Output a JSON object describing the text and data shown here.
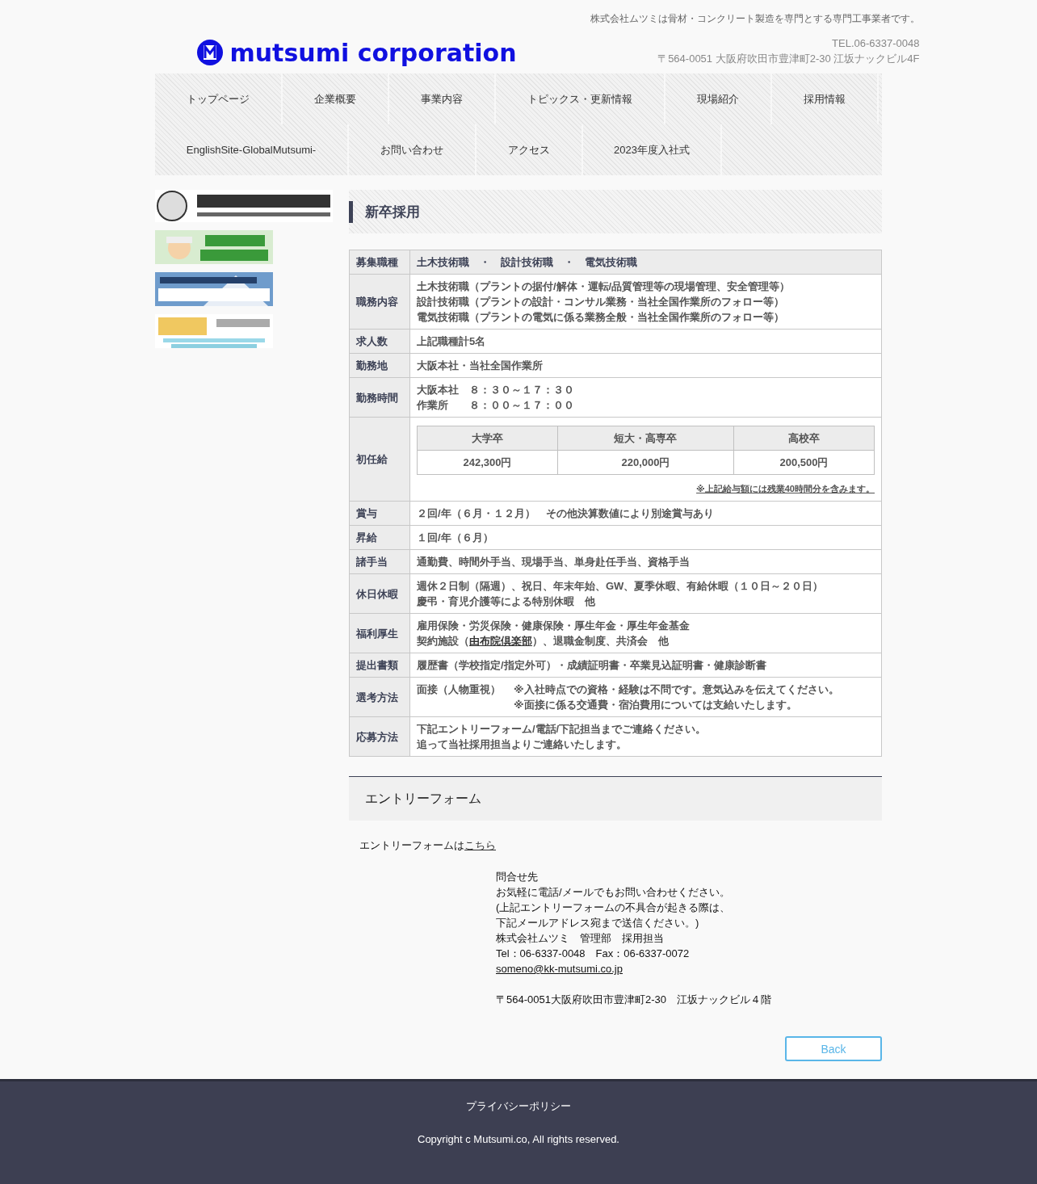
{
  "header": {
    "tagline": "株式会社ムツミは骨材・コンクリート製造を専門とする専門工事業者です。",
    "logo_text": "mutsumi corporation",
    "tel": "TEL.06-6337-0048",
    "address": "〒564-0051 大阪府吹田市豊津町2-30 江坂ナックビル4F"
  },
  "nav": [
    [
      "トップページ",
      "企業概要",
      "事業内容",
      "トピックス・更新情報",
      "現場紹介",
      "採用情報"
    ],
    [
      "EnglishSite-GlobalMutsumi-",
      "お問い合わせ",
      "アクセス",
      "2023年度入社式"
    ]
  ],
  "page_title": "新卒採用",
  "table": [
    {
      "label": "募集職種",
      "kind": "lines",
      "head": true,
      "lines": [
        "土木技術職　・　設計技術職　・　電気技術職"
      ]
    },
    {
      "label": "職務内容",
      "kind": "lines",
      "lines": [
        "土木技術職（プラントの据付/解体・運転/品質管理等の現場管理、安全管理等）",
        "設計技術職（プラントの設計・コンサル業務・当社全国作業所のフォロー等）",
        "電気技術職（プラントの電気に係る業務全般・当社全国作業所のフォロー等）"
      ]
    },
    {
      "label": "求人数",
      "kind": "lines",
      "lines": [
        "上記職種計5名"
      ]
    },
    {
      "label": "勤務地",
      "kind": "lines",
      "lines": [
        "大阪本社・当社全国作業所"
      ]
    },
    {
      "label": "勤務時間",
      "kind": "lines",
      "lines": [
        "大阪本社　８：３０～１７：３０",
        "作業所　　８：００～１７：００"
      ]
    },
    {
      "label": "初任給",
      "kind": "salary",
      "columns": [
        "大学卒",
        "短大・高専卒",
        "高校卒"
      ],
      "values": [
        "242,300円",
        "220,000円",
        "200,500円"
      ],
      "note": "※上記給与額には残業40時間分を含みます。"
    },
    {
      "label": "賞与",
      "kind": "lines",
      "lines": [
        "２回/年（６月・１２月）　その他決算数値により別途賞与あり"
      ]
    },
    {
      "label": "昇給",
      "kind": "lines",
      "lines": [
        "１回/年（６月）"
      ]
    },
    {
      "label": "諸手当",
      "kind": "lines",
      "lines": [
        "通勤費、時間外手当、現場手当、単身赴任手当、資格手当"
      ]
    },
    {
      "label": "休日休暇",
      "kind": "lines",
      "lines": [
        "週休２日制（隔週）、祝日、年末年始、GW、夏季休暇、有給休暇（１０日～２０日）",
        "慶弔・育児介護等による特別休暇　他"
      ]
    },
    {
      "label": "福利厚生",
      "kind": "link",
      "lines": [
        "雇用保険・労災保険・健康保険・厚生年金・厚生年金基金"
      ],
      "before": "契約施設（",
      "link": "由布院倶楽部",
      "after": "）、退職金制度、共済会　他"
    },
    {
      "label": "提出書類",
      "kind": "lines",
      "lines": [
        "履歴書（学校指定/指定外可）・成績証明書・卒業見込証明書・健康診断書"
      ]
    },
    {
      "label": "選考方法",
      "kind": "split",
      "lead": "面接（人物重視）",
      "notes": [
        "※入社時点での資格・経験は不問です。意気込みを伝えてください。",
        "※面接に係る交通費・宿泊費用については支給いたします。"
      ]
    },
    {
      "label": "応募方法",
      "kind": "lines",
      "lines": [
        "下記エントリーフォーム/電話/下記担当までご連絡ください。",
        "追って当社採用担当よりご連絡いたします。"
      ]
    }
  ],
  "entry": {
    "title": "エントリーフォーム",
    "text": "エントリーフォームは",
    "link": "こちら"
  },
  "contact": {
    "lines": [
      "問合せ先",
      "お気軽に電話/メールでもお問い合わせください。",
      "(上記エントリーフォームの不具合が起きる際は、",
      "下記メールアドレス宛まで送信ください。)",
      "株式会社ムツミ　管理部　採用担当",
      "Tel：06-6337-0048　Fax：06-6337-0072"
    ],
    "email": "someno@kk-mutsumi.co.jp",
    "address": "〒564-0051大阪府吹田市豊津町2-30　江坂ナックビル４階"
  },
  "back_button": "Back",
  "footer": {
    "link": "プライバシーポリシー",
    "copyright": "Copyright c Mutsumi.co, All rights reserved."
  }
}
